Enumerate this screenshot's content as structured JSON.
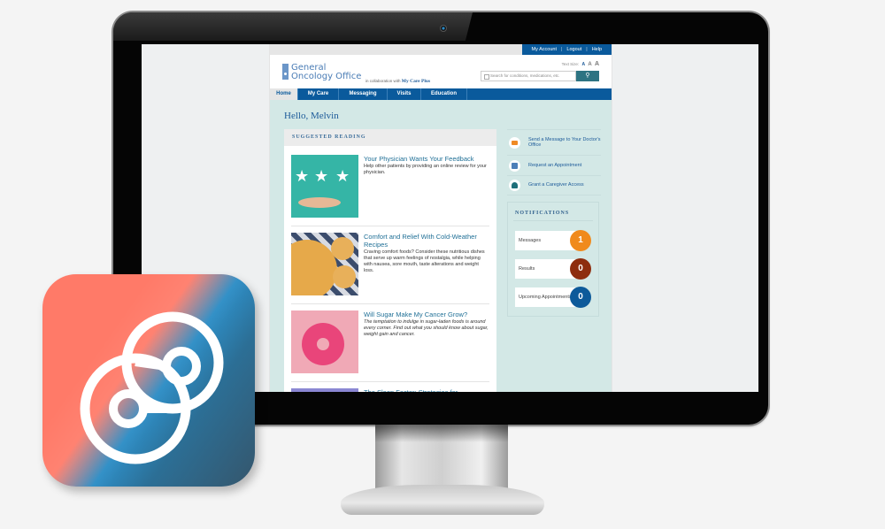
{
  "site": {
    "account_links": [
      "My Account",
      "Logout",
      "Help"
    ],
    "logo_line1": "General",
    "logo_line2": "Oncology Office",
    "collab_prefix": "in collaboration with",
    "collab_brand": "My Care Plus",
    "text_size_label": "Text Size:",
    "text_size_options": [
      "A",
      "A",
      "A"
    ],
    "search_placeholder": "Search for conditions, medications, etc.",
    "search_icon": "magnifier-icon",
    "nav": [
      {
        "label": "Home",
        "active": true
      },
      {
        "label": "My Care",
        "active": false
      },
      {
        "label": "Messaging",
        "active": false
      },
      {
        "label": "Visits",
        "active": false
      },
      {
        "label": "Education",
        "active": false
      }
    ],
    "greeting": "Hello, Melvin"
  },
  "suggested_reading": {
    "title": "SUGGESTED READING",
    "articles": [
      {
        "title": "Your Physician Wants Your Feedback",
        "description": "Help other patients by providing an online review for your physician.",
        "italic": false,
        "thumb": "doctor-hand-stars-image"
      },
      {
        "title": "Comfort and Relief With Cold-Weather Recipes",
        "description": "Craving comfort foods? Consider these nutritious dishes that serve up warm feelings of nostalgia, while helping with nausea, sore mouth, taste alterations and weight loss.",
        "italic": false,
        "thumb": "pot-pie-image"
      },
      {
        "title": "Will Sugar Make My Cancer Grow?",
        "description": "The temptation to indulge in sugar-laden foods is around every corner. Find out what you should know about sugar, weight gain and cancer.",
        "italic": true,
        "thumb": "pink-donut-image"
      },
      {
        "title": "The Sleep Factor: Strategies for",
        "description": "",
        "italic": false,
        "thumb": "sleep-image"
      }
    ]
  },
  "quick_actions": [
    {
      "label": "Send a Message to Your Doctor's Office",
      "icon": "envelope-icon"
    },
    {
      "label": "Request an Appointment",
      "icon": "calendar-icon"
    },
    {
      "label": "Grant a Caregiver Access",
      "icon": "people-icon"
    }
  ],
  "notifications": {
    "title": "NOTIFICATIONS",
    "items": [
      {
        "label": "Messages",
        "count": "1",
        "color": "#f08a1c"
      },
      {
        "label": "Results",
        "count": "0",
        "color": "#8e2d0e"
      },
      {
        "label": "Upcoming Appointments",
        "count": "0",
        "color": "#0d5a9a"
      }
    ]
  },
  "app_icon": {
    "name": "app-logo",
    "colors": {
      "coral": "#ff7a68",
      "blue": "#2e8ec6",
      "slate": "#35566c"
    }
  }
}
